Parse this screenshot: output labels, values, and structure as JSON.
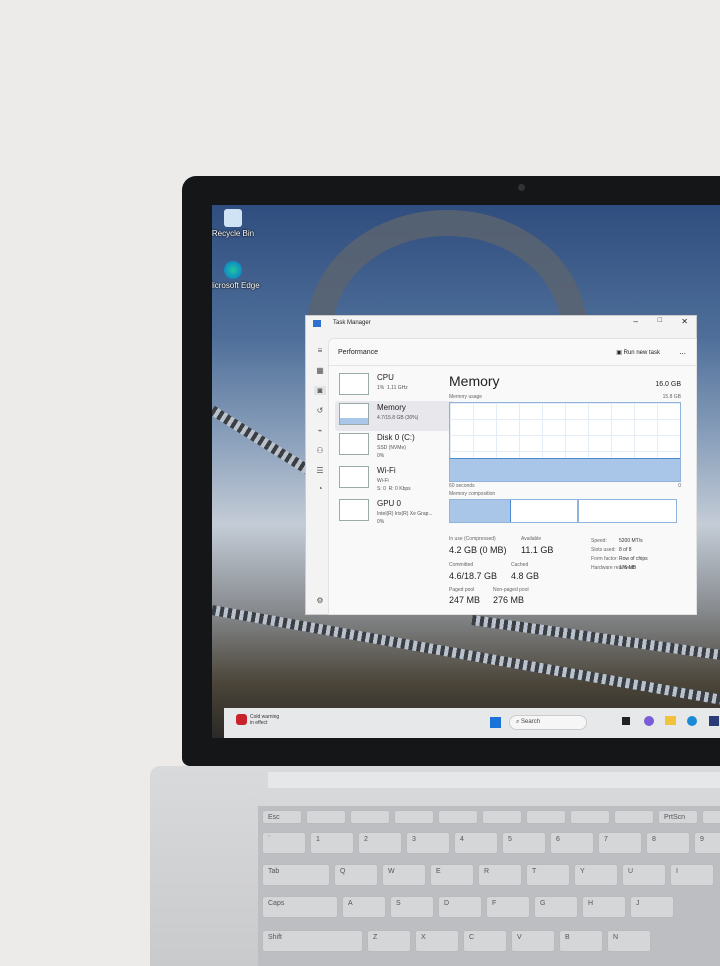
{
  "desktop": {
    "icons": [
      {
        "label": "Recycle Bin"
      },
      {
        "label": "Microsoft Edge"
      }
    ]
  },
  "task_manager": {
    "title": "Task Manager",
    "section": "Performance",
    "run_new_task": "Run new task",
    "more": "...",
    "items": [
      {
        "name": "CPU",
        "sub": "1%  1.11 GHz"
      },
      {
        "name": "Memory",
        "sub": "4.7/15.8 GB (30%)"
      },
      {
        "name": "Disk 0 (C:)",
        "sub": "SSD (NVMe)\n0%"
      },
      {
        "name": "Wi-Fi",
        "sub": "Wi-Fi\nS: 0  R: 0 Kbps"
      },
      {
        "name": "GPU 0",
        "sub": "Intel(R) Iris(R) Xe Grap...\n0%"
      }
    ],
    "memory": {
      "heading": "Memory",
      "total": "16.0 GB",
      "usage_label": "Memory usage",
      "usage_max": "15.8 GB",
      "time_label": "60 seconds",
      "zero": "0",
      "composition_label": "Memory composition",
      "usage_fraction": 0.3,
      "in_use_label": "In use (Compressed)",
      "in_use": "4.2 GB (0 MB)",
      "available_label": "Available",
      "available": "11.1 GB",
      "committed_label": "Committed",
      "committed": "4.6/18.7 GB",
      "cached_label": "Cached",
      "cached": "4.8 GB",
      "paged_label": "Paged pool",
      "paged": "247 MB",
      "nonpaged_label": "Non-paged pool",
      "nonpaged": "276 MB",
      "speed_label": "Speed:",
      "speed": "5200 MT/s",
      "slots_label": "Slots used:",
      "slots": "8 of 8",
      "form_label": "Form factor:",
      "form": "Row of chips",
      "hw_label": "Hardware reserved:",
      "hw": "176 MB"
    }
  },
  "taskbar": {
    "weather": "Cold warning\nin effect",
    "search": "Search"
  },
  "keyboard": {
    "frow": [
      "Esc",
      "",
      "",
      "",
      "",
      "",
      "",
      "",
      "",
      "PrtScn",
      ""
    ],
    "numrow": [
      "`",
      "1",
      "2",
      "3",
      "4",
      "5",
      "6",
      "7",
      "8",
      "9"
    ],
    "row1": [
      "Tab",
      "Q",
      "W",
      "E",
      "R",
      "T",
      "Y",
      "U",
      "I"
    ],
    "row2": [
      "Caps",
      "A",
      "S",
      "D",
      "F",
      "G",
      "H",
      "J"
    ],
    "row3": [
      "Shift",
      "Z",
      "X",
      "C",
      "V",
      "B",
      "N"
    ]
  }
}
